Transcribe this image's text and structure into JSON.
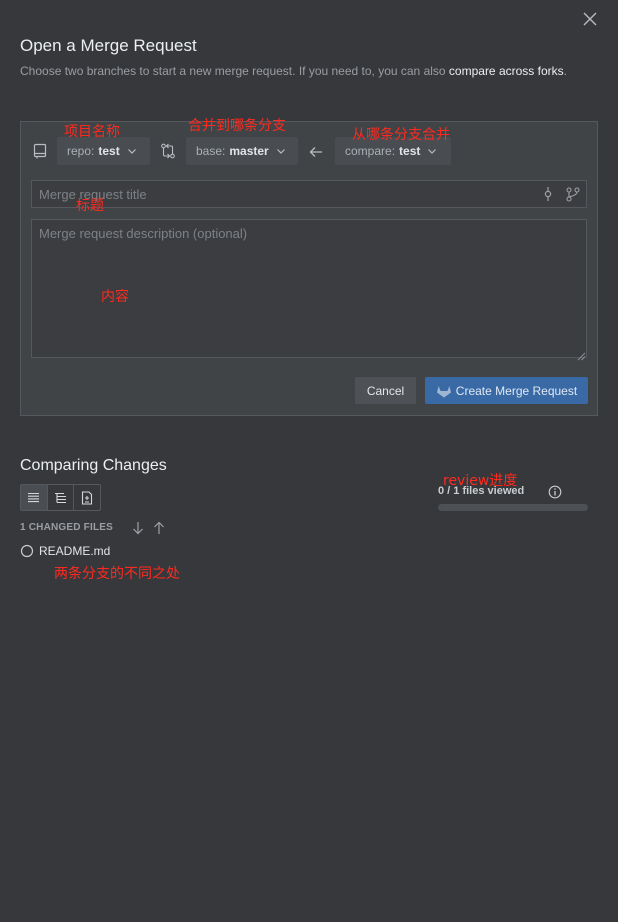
{
  "dialog": {
    "title": "Open a Merge Request",
    "subtitle_text": "Choose two branches to start a new merge request. If you need to, you can also ",
    "subtitle_link": "compare across forks",
    "subtitle_end": "."
  },
  "branches": {
    "repo_label": "repo:",
    "repo_value": "test",
    "base_label": "base:",
    "base_value": "master",
    "compare_label": "compare:",
    "compare_value": "test"
  },
  "form": {
    "title_placeholder": "Merge request title",
    "description_placeholder": "Merge request description (optional)",
    "cancel_label": "Cancel",
    "create_label": "Create Merge Request"
  },
  "changes": {
    "section_title": "Comparing Changes",
    "changed_files_label": "1 CHANGED FILES",
    "files": [
      {
        "name": "README.md"
      }
    ],
    "files_viewed": "0 / 1 files viewed",
    "progress": 0
  },
  "annotations": {
    "repo_name": "项目名称",
    "merge_into": "合并到哪条分支",
    "merge_from": "从哪条分支合并",
    "title_note": "标题",
    "content_note": "内容",
    "review_progress": "review进度",
    "branch_diff": "两条分支的不同之处"
  },
  "colors": {
    "background": "#36383b",
    "panel": "#414447",
    "primary_button": "#3a6aa6",
    "annotation": "#ff2a1f"
  }
}
